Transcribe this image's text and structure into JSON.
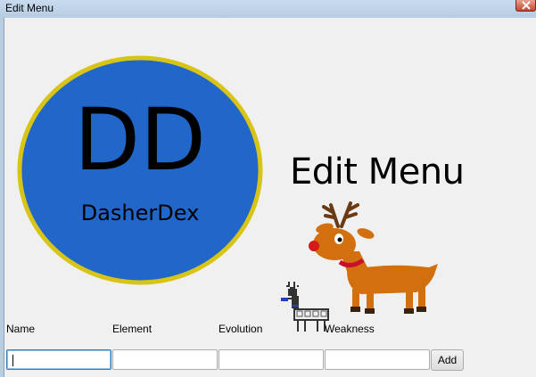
{
  "window": {
    "title": "Edit Menu"
  },
  "logo": {
    "initials": "DD",
    "name": "DasherDex"
  },
  "heading": "Edit Menu",
  "form": {
    "labels": [
      "Name",
      "Element",
      "Evolution",
      "Weakness"
    ],
    "add_label": "Add"
  },
  "colors": {
    "logo_fill": "#2166c9",
    "logo_ring": "#d8c416",
    "reindeer_body": "#d2700f"
  },
  "icons": {
    "close": "close-icon"
  }
}
